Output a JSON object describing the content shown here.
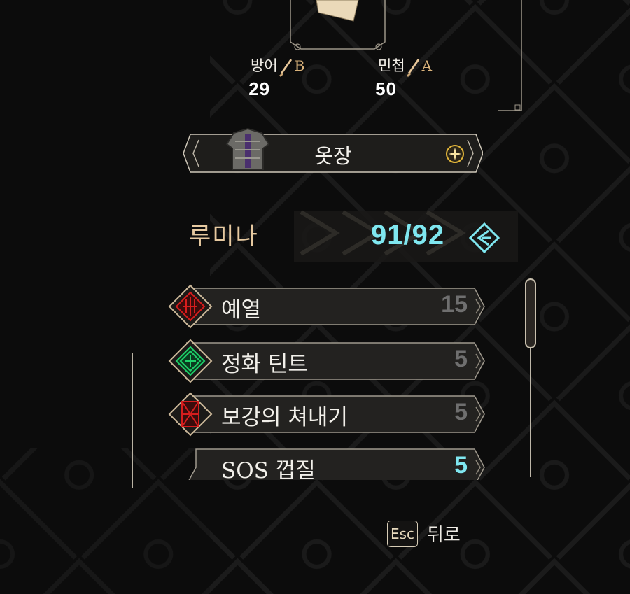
{
  "stats": [
    {
      "label": "방어",
      "grade": "B",
      "value": "29"
    },
    {
      "label": "민첩",
      "grade": "A",
      "value": "50"
    }
  ],
  "category": {
    "title": "옷장"
  },
  "currency": {
    "name": "루미나",
    "value": "91/92"
  },
  "items": [
    {
      "label": "예열",
      "count": "15",
      "icon": "heat-rune-icon",
      "color": "#d61d1d"
    },
    {
      "label": "정화 틴트",
      "count": "5",
      "icon": "purify-rune-icon",
      "color": "#1fd16a"
    },
    {
      "label": "보강의 쳐내기",
      "count": "5",
      "icon": "reinforce-rune-icon",
      "color": "#d61d1d"
    },
    {
      "label": "SOS 껍질",
      "count": "5",
      "icon": "",
      "color": ""
    }
  ],
  "footer": {
    "key": "Esc",
    "label": "뒤로"
  },
  "colors": {
    "accent": "#7fe7f0",
    "gold": "#d9b27a",
    "background": "#0c0c0c"
  }
}
